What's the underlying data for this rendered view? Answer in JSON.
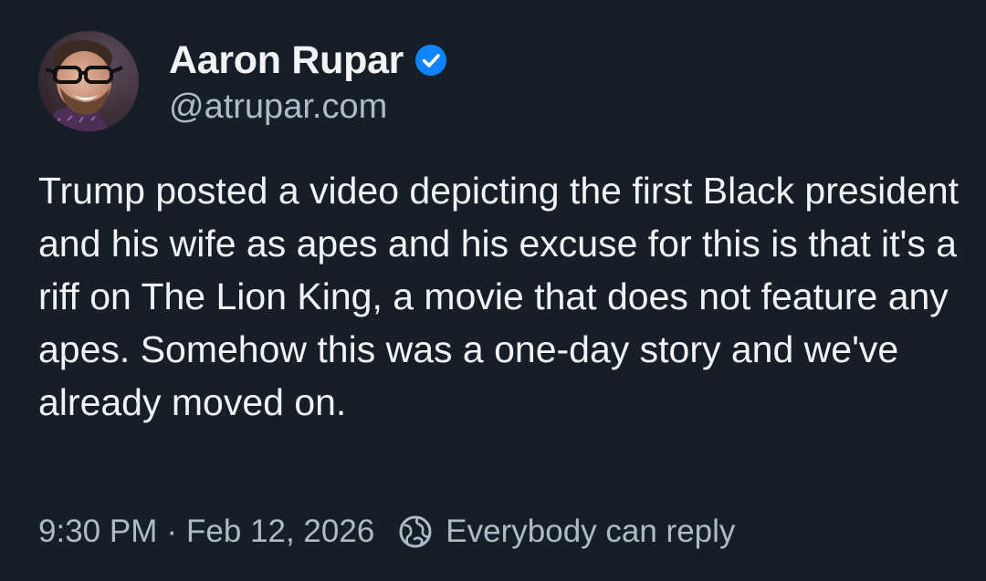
{
  "post": {
    "author": {
      "display_name": "Aaron Rupar",
      "handle": "@atrupar.com",
      "verified": true,
      "avatar_icon": "avatar-photo"
    },
    "text": "Trump posted a video depicting the first Black president and his wife as apes and his excuse for this is that it's a riff on The Lion King, a movie that does not feature any apes. Somehow this was a one-day story and we've already moved on.",
    "time": "9:30 PM",
    "separator": "·",
    "date": "Feb 12, 2026",
    "reply_setting": "Everybody can reply",
    "reply_icon": "globe-icon"
  },
  "colors": {
    "background": "#161e27",
    "text_primary": "#f1f3f5",
    "text_secondary": "#aebbc9",
    "verified_badge": "#1083fe"
  }
}
